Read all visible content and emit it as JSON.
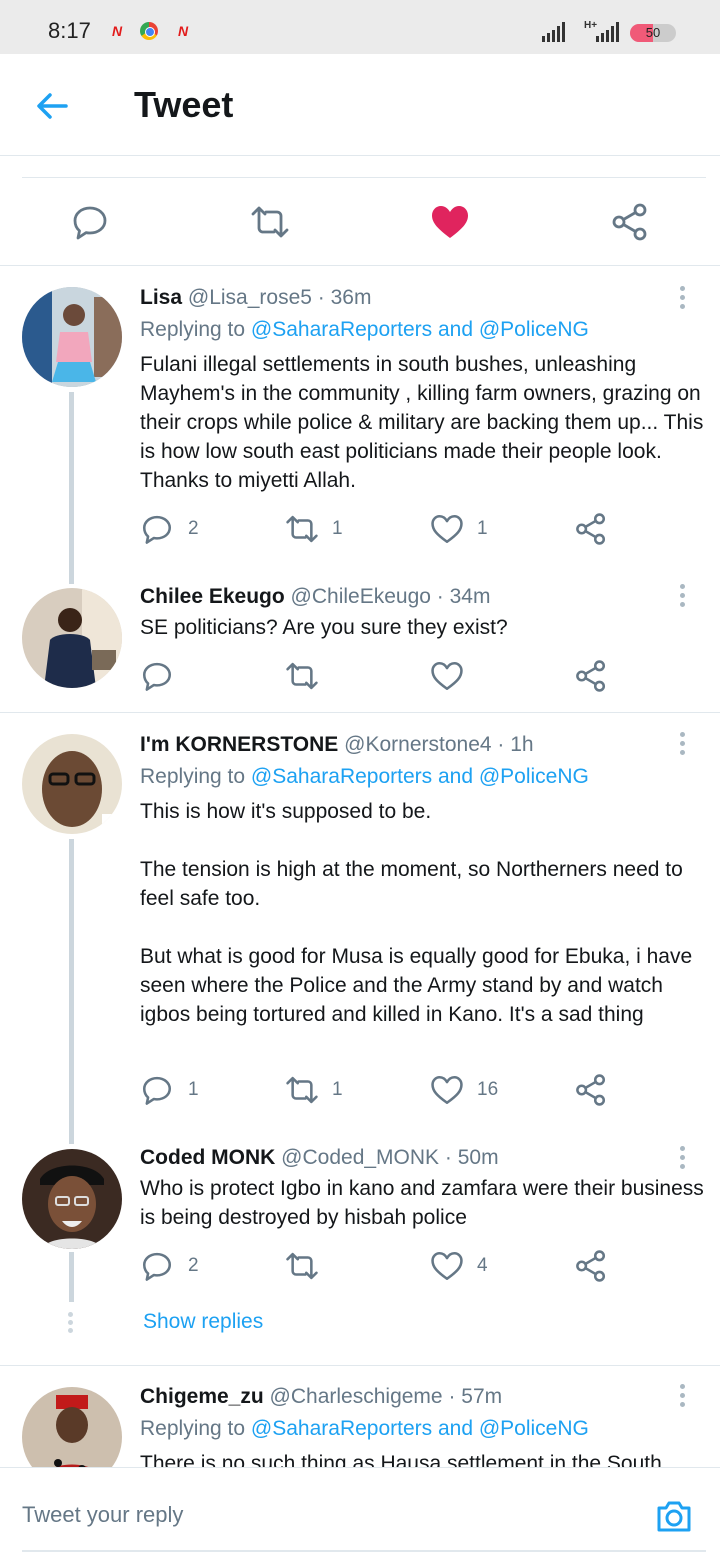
{
  "status_bar": {
    "time": "8:17",
    "notif_icons": [
      "news-icon",
      "chrome-icon",
      "news-icon"
    ],
    "network": "H+",
    "battery": "50",
    "battery_level_percent": 50
  },
  "header": {
    "back_icon": "back-arrow-icon",
    "title": "Tweet"
  },
  "main_actions": [
    "reply-icon",
    "retweet-icon",
    "liked-heart-icon",
    "share-icon"
  ],
  "colors": {
    "accent": "#1da1f2",
    "like": "#e0245e",
    "secondary_text": "#657786",
    "divider": "#e1e8ed"
  },
  "replies": [
    {
      "name": "Lisa",
      "handle": "@Lisa_rose5",
      "time": "· 36m",
      "replying_prefix": "Replying to",
      "replying_to": "@SaharaReporters and @PoliceNG",
      "text": "Fulani illegal settlements in south bushes, unleashing Mayhem's in the community , killing farm owners, grazing on their crops while police & military are backing them up... This is how low south east politicians made their people  look. Thanks to miyetti Allah.",
      "replies": "2",
      "retweets": "1",
      "likes": "1"
    },
    {
      "name": "Chilee Ekeugo",
      "handle": "@ChileEkeugo",
      "time": "· 34m",
      "text": "SE politicians? Are you sure they exist?",
      "replies": "",
      "retweets": "",
      "likes": ""
    },
    {
      "name": "I'm KORNERSTONE",
      "handle": "@Kornerstone4",
      "time": "· 1h",
      "replying_prefix": "Replying to",
      "replying_to": "@SaharaReporters and @PoliceNG",
      "text": "This is how it's supposed to be.\n\nThe tension is high at the moment, so Northerners need to feel safe too.\n\nBut what is good for Musa is equally good for Ebuka, i have seen where the Police and the Army stand by and watch igbos being tortured and killed in Kano. It's a sad thing",
      "replies": "1",
      "retweets": "1",
      "likes": "16"
    },
    {
      "name": "Coded MONK",
      "handle": "@Coded_MONK",
      "time": "· 50m",
      "text": "Who is protect Igbo in kano and zamfara were their business is being destroyed by hisbah police",
      "replies": "2",
      "retweets": "",
      "likes": "4"
    },
    {
      "name": "Chigeme_zu",
      "handle": "@Charleschigeme",
      "time": "· 57m",
      "replying_prefix": "Replying to",
      "replying_to": "@SaharaReporters and @PoliceNG",
      "text": "There is no such thing as Hausa settlement in the South"
    }
  ],
  "show_replies": "Show replies",
  "reply_bar": {
    "placeholder": "Tweet your reply",
    "camera_icon": "camera-icon"
  }
}
